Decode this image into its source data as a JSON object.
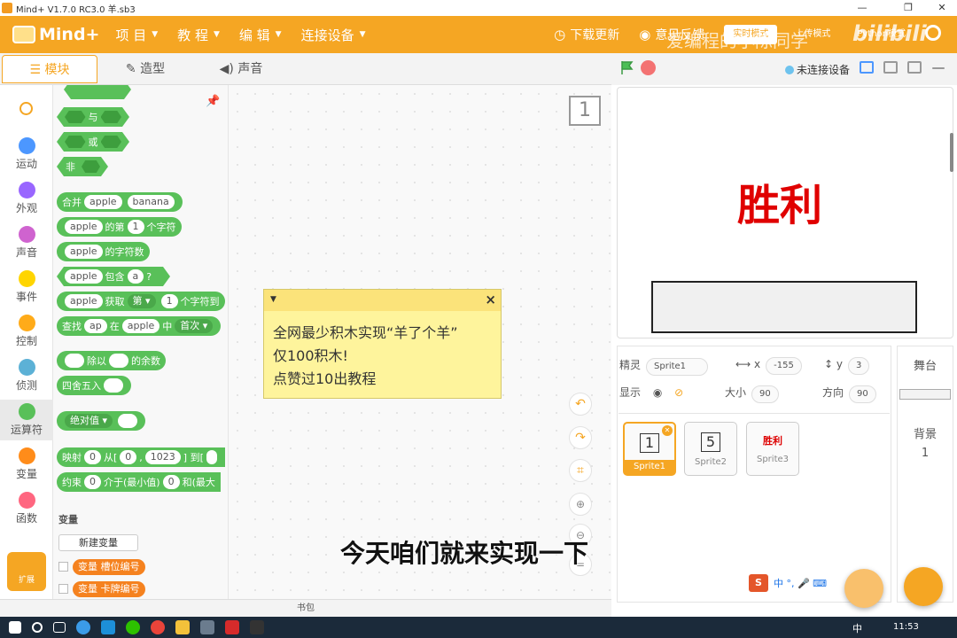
{
  "titlebar": {
    "title": "Mind+ V1.7.0 RC3.0   羊.sb3"
  },
  "menubar": {
    "logo": "Mind+",
    "menus": [
      "项 目",
      "教 程",
      "编 辑",
      "连接设备"
    ],
    "download_update": "下载更新",
    "feedback": "意见反馈",
    "modes": [
      "实时模式",
      "上传模式",
      "Python模式"
    ]
  },
  "watermark": "爱编程的小陈同学",
  "bilibili": "bilibili",
  "tabs": [
    "模块",
    "造型",
    "声音"
  ],
  "connection": "未连接设备",
  "categories": [
    {
      "label": "运动",
      "color": "#4c97ff"
    },
    {
      "label": "外观",
      "color": "#9966ff"
    },
    {
      "label": "声音",
      "color": "#cf63cf"
    },
    {
      "label": "事件",
      "color": "#ffd500"
    },
    {
      "label": "控制",
      "color": "#ffab19"
    },
    {
      "label": "侦测",
      "color": "#5cb1d6"
    },
    {
      "label": "运算符",
      "color": "#59c059"
    },
    {
      "label": "变量",
      "color": "#ff8c1a"
    },
    {
      "label": "函数",
      "color": "#ff6680"
    }
  ],
  "extension": "扩展",
  "blocks": {
    "and": "与",
    "or": "或",
    "not": "非",
    "join": "合并",
    "apple": "apple",
    "banana": "banana",
    "letter_of": "的第",
    "one": "1",
    "char": "个字符",
    "length": "的字符数",
    "contains": "包含",
    "a": "a",
    "q": "?",
    "get": "获取",
    "nth": "第",
    "chars_to": "个字符到",
    "find": "查找",
    "ap": "ap",
    "in": "在",
    "mid": "中",
    "first": "首次",
    "mod_a": "除以",
    "mod_b": "的余数",
    "round": "四舍五入",
    "abs": "绝对值",
    "map": "映射",
    "zero": "0",
    "from": "从[",
    "n1023": "1023",
    "to": "] 到[",
    "constrain": "约束",
    "between": "介于(最小值)",
    "and_max": "和(最大"
  },
  "variables": {
    "header": "变量",
    "new_var": "新建变量",
    "var1": "变量 槽位编号",
    "var2": "变量 卡牌编号"
  },
  "workspace": {
    "sprite_badge": "1",
    "comment_lines": [
      "全网最少积木实现“羊了个羊”",
      "仅100积木!",
      "点赞过10出教程"
    ],
    "subtitle": "今天咱们就来实现一下",
    "bag": "书包"
  },
  "stage": {
    "win_text": "胜利"
  },
  "sprite_props": {
    "sprite_label": "精灵",
    "sprite_name": "Sprite1",
    "x_label": "x",
    "x": "-155",
    "y_label": "y",
    "y": "3",
    "show_label": "显示",
    "size_label": "大小",
    "size": "90",
    "dir_label": "方向",
    "direction": "90"
  },
  "sprites": [
    {
      "name": "Sprite1",
      "thumb": "1"
    },
    {
      "name": "Sprite2",
      "thumb": "5"
    },
    {
      "name": "Sprite3",
      "thumb": "胜利"
    }
  ],
  "backdrop": {
    "stage_label": "舞台",
    "backdrop_label": "背景",
    "count": "1"
  },
  "ime": {
    "items": "中 °, 🎤 ⌨"
  },
  "taskbar": {
    "ime": "中",
    "clock": "11:53"
  }
}
